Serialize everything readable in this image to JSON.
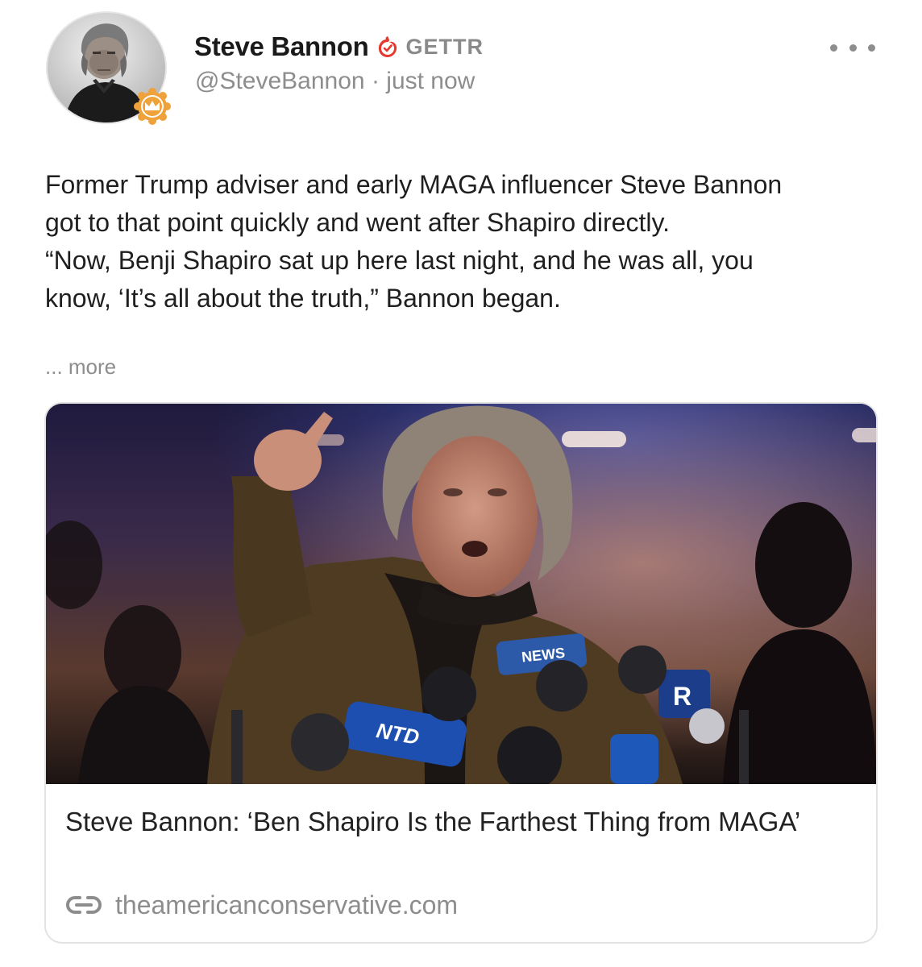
{
  "post": {
    "author": {
      "display_name": "Steve Bannon",
      "platform": "GETTR",
      "handle": "@SteveBannon",
      "separator": " · ",
      "timestamp": "just now",
      "verified_icon": "verified-check-icon",
      "avatar_badge_icon": "crown-badge-icon"
    },
    "menu_icon": "more-dots-icon",
    "text_lines": [
      "Former Trump adviser and early MAGA influencer Steve Bannon",
      "got to that point quickly and went after Shapiro directly.",
      "“Now, Benji Shapiro sat up here last night, and he was all, you",
      "know, ‘It’s all about the truth,” Bannon began."
    ],
    "more_label": "... more",
    "link_card": {
      "title": "Steve Bannon: ‘Ben Shapiro Is the Farthest Thing from MAGA’",
      "link_icon": "link-icon",
      "domain": "theamericanconservative.com",
      "image_mic_labels": [
        "NEWS",
        "NTD",
        "R"
      ]
    }
  },
  "colors": {
    "verified": "#e8372d",
    "badge": "#f0a23a",
    "muted_text": "#8d8d8d",
    "card_border": "#e3e3e3"
  }
}
